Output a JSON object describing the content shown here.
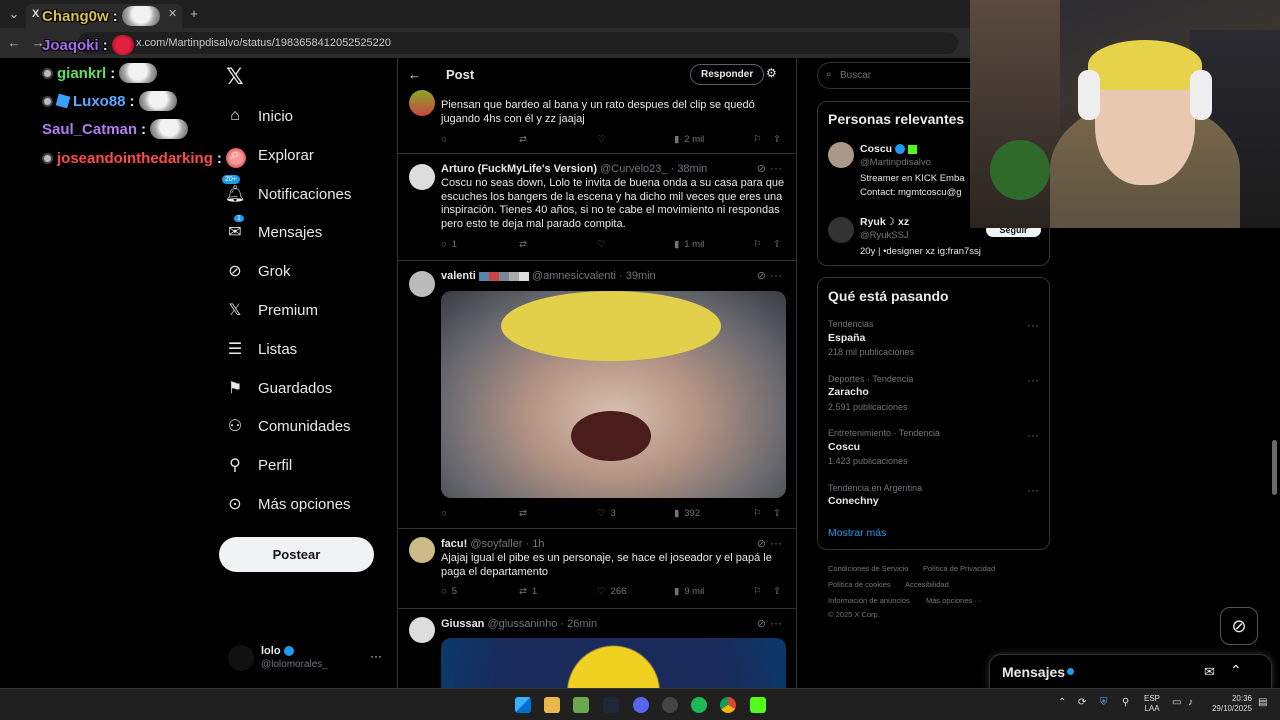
{
  "browser": {
    "tab_title": "X",
    "url": "x.com/Martinpdisalvo/status/1983658412052525220"
  },
  "chat": [
    {
      "user": "Chang0w",
      "color": "#d8c24a"
    },
    {
      "user": "Joaqoki",
      "color": "#a56cf0"
    },
    {
      "user": "giankrl",
      "color": "#5ee05e"
    },
    {
      "user": "Luxo88",
      "color": "#5aa8ff"
    },
    {
      "user": "Saul_Catman",
      "color": "#b27cf2"
    },
    {
      "user": "joseandointhedarking",
      "color": "#ff4a4a"
    }
  ],
  "nav": {
    "items": [
      {
        "label": "Inicio",
        "icon": "home-icon"
      },
      {
        "label": "Explorar",
        "icon": "search-icon"
      },
      {
        "label": "Notificaciones",
        "icon": "bell-icon",
        "badge": "20+"
      },
      {
        "label": "Mensajes",
        "icon": "mail-icon",
        "badge": "1"
      },
      {
        "label": "Grok",
        "icon": "grok-icon"
      },
      {
        "label": "Premium",
        "icon": "x-logo-icon"
      },
      {
        "label": "Listas",
        "icon": "list-icon"
      },
      {
        "label": "Guardados",
        "icon": "bookmark-icon"
      },
      {
        "label": "Comunidades",
        "icon": "communities-icon"
      },
      {
        "label": "Perfil",
        "icon": "person-icon"
      },
      {
        "label": "Más opciones",
        "icon": "more-circle-icon"
      }
    ],
    "post_button": "Postear",
    "account": {
      "name": "lolo",
      "handle": "@lolomorales_"
    }
  },
  "header": {
    "title": "Post",
    "reply_button": "Responder"
  },
  "tweets": [
    {
      "name": "",
      "handle": "",
      "time": "",
      "text": "Piensan que bardeo al bana y un rato despues del clip se quedó jugando 4hs con él y zz jaajaj",
      "replies": "",
      "retweets": "",
      "likes": "",
      "views": "2 mil"
    },
    {
      "name": "Arturo (FuckMyLife's Version)",
      "handle": "@Curvelo23_",
      "time": "· 38min",
      "text": "Coscu no seas down, Lolo te invita de buena onda a su casa para que escuches los bangers de la escena y ha dicho mil veces que eres una inspiración. Tienes 40 años, si no te cabe el movimiento ni respondas pero esto te deja mal parado compita.",
      "replies": "1",
      "retweets": "",
      "likes": "",
      "views": "1 mil"
    },
    {
      "name": "valenti",
      "handle": "@amnesicvalenti",
      "time": "· 39min",
      "text": "",
      "replies": "",
      "retweets": "",
      "likes": "3",
      "views": "392"
    },
    {
      "name": "facu!",
      "handle": "@soyfaller",
      "time": "· 1h",
      "text": "Ajajaj igual el pibe es un personaje, se hace el joseador y el papá le paga el departamento",
      "replies": "5",
      "retweets": "1",
      "likes": "266",
      "views": "9 mil"
    },
    {
      "name": "Giussan",
      "handle": "@giussaninho",
      "time": "· 26min",
      "text": "",
      "replies": "",
      "retweets": "",
      "likes": "",
      "views": ""
    }
  ],
  "search": {
    "placeholder": "Buscar"
  },
  "relevant": {
    "title": "Personas relevantes",
    "people": [
      {
        "name": "Coscu",
        "handle": "@Martinpdisalvo",
        "bio1": "Streamer en KICK Emba",
        "bio2": "Contact: mgmtcoscu@g"
      },
      {
        "name": "Ryuk☽ xz",
        "handle": "@RyukSSJ",
        "bio1": "20y | •designer xz ig:fran7ssj",
        "follow": "Seguir"
      }
    ]
  },
  "trends": {
    "title": "Qué está pasando",
    "items": [
      {
        "meta": "Tendencias",
        "name": "España",
        "count": "218 mil publicaciones"
      },
      {
        "meta": "Deportes · Tendencia",
        "name": "Zaracho",
        "count": "2.591 publicaciones"
      },
      {
        "meta": "Entretenimiento · Tendencia",
        "name": "Coscu",
        "count": "1.423 publicaciones"
      },
      {
        "meta": "Tendencia en Argentina",
        "name": "Conechny",
        "count": ""
      }
    ],
    "show_more": "Mostrar más"
  },
  "footer": {
    "terms": "Condiciones de Servicio",
    "privacy": "Política de Privacidad",
    "cookies": "Política de cookies",
    "accessibility": "Accesibilidad",
    "ads": "Información de anuncios",
    "more": "Más opciones ···",
    "copyright": "© 2025 X Corp."
  },
  "messages_drawer": {
    "label": "Mensajes"
  },
  "taskbar": {
    "lang1": "ESP",
    "lang2": "LAA",
    "time": "20:36",
    "date": "29/10/2025"
  }
}
